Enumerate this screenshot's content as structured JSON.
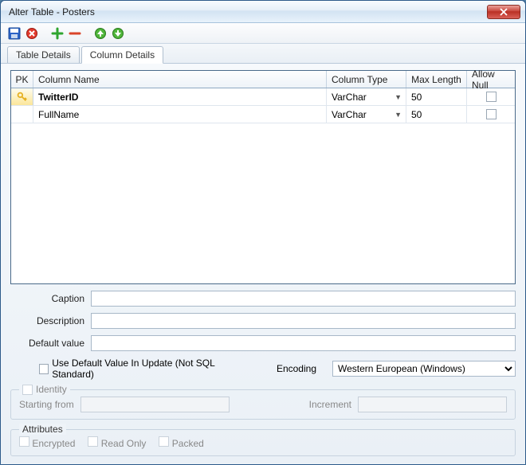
{
  "window": {
    "title": "Alter Table - Posters"
  },
  "toolbar": {
    "save": "save",
    "cancel": "cancel",
    "add": "add",
    "remove": "remove",
    "up": "up",
    "down": "down"
  },
  "tabs": {
    "table_details": "Table Details",
    "column_details": "Column Details",
    "active_index": 1
  },
  "grid": {
    "headers": {
      "pk": "PK",
      "name": "Column Name",
      "type": "Column Type",
      "max_length": "Max Length",
      "allow_null": "Allow Null"
    },
    "rows": [
      {
        "pk": true,
        "name": "TwitterID",
        "type": "VarChar",
        "max_length": "50",
        "allow_null": false,
        "selected": true
      },
      {
        "pk": false,
        "name": "FullName",
        "type": "VarChar",
        "max_length": "50",
        "allow_null": false,
        "selected": false
      }
    ]
  },
  "fields": {
    "caption_label": "Caption",
    "caption_value": "",
    "description_label": "Description",
    "description_value": "",
    "default_label": "Default value",
    "default_value": "",
    "use_default_label": "Use Default Value In Update (Not SQL Standard)",
    "use_default_checked": false,
    "encoding_label": "Encoding",
    "encoding_value": "Western European (Windows)"
  },
  "identity": {
    "legend": "Identity",
    "checked": false,
    "starting_label": "Starting from",
    "starting_value": "",
    "increment_label": "Increment",
    "increment_value": ""
  },
  "attributes": {
    "legend": "Attributes",
    "encrypted_label": "Encrypted",
    "readonly_label": "Read Only",
    "packed_label": "Packed"
  }
}
